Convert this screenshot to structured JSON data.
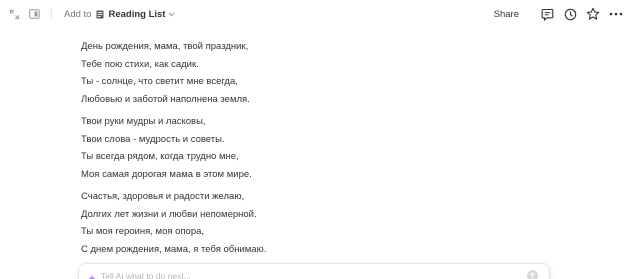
{
  "topbar": {
    "add_to_label": "Add to",
    "database_name": "Reading List",
    "share_label": "Share",
    "icons": [
      "expand-icon",
      "side-peek-icon",
      "database-icon",
      "chevron-down-icon",
      "comments-icon",
      "updates-clock-icon",
      "favorite-star-icon",
      "more-icon"
    ]
  },
  "content": {
    "stanzas": [
      {
        "lines": [
          "День рождения, мама, твой праздник,",
          "Тебе пою стихи, как садик.",
          "Ты - солнце, что светит мне всегда,",
          "Любовью и заботой наполнена земля."
        ]
      },
      {
        "lines": [
          "Твои руки мудры и ласковы,",
          "Твои слова - мудрость и советы.",
          "Ты всегда рядом, когда трудно мне,",
          "Моя самая дорогая мама в этом мире."
        ]
      },
      {
        "lines": [
          "Счастья, здоровья и радости желаю,",
          "Долгих лет жизни и любви непомерной.",
          "Ты моя героиня, моя опора,",
          "С днем рождения, мама, я тебя обнимаю."
        ]
      }
    ],
    "block_handle": ":::"
  },
  "ai_bar": {
    "placeholder": "Tell AI what to do next...",
    "value": ""
  },
  "colors": {
    "text": "#37352f",
    "muted": "#787774",
    "placeholder": "#b9b7b2",
    "ai_spark": "#a68bd9"
  }
}
